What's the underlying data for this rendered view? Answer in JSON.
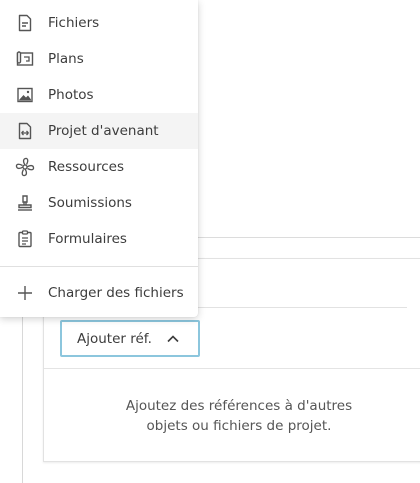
{
  "menu": {
    "items": [
      {
        "label": "Fichiers",
        "icon": "file-icon"
      },
      {
        "label": "Plans",
        "icon": "plans-icon"
      },
      {
        "label": "Photos",
        "icon": "photo-icon"
      },
      {
        "label": "Projet d'avenant",
        "icon": "change-order-icon"
      },
      {
        "label": "Ressources",
        "icon": "fan-icon"
      },
      {
        "label": "Soumissions",
        "icon": "stamp-icon"
      },
      {
        "label": "Formulaires",
        "icon": "clipboard-icon"
      }
    ],
    "upload_label": "Charger des fichiers",
    "upload_icon": "plus-icon",
    "active_item": "Projet d'avenant"
  },
  "references": {
    "add_button_label": "Ajouter réf.",
    "add_button_icon": "chevron-up-icon",
    "empty_line1": "Ajoutez des références à d'autres",
    "empty_line2": "objets ou fichiers de projet."
  },
  "colors": {
    "focus_border": "#8cc6dd",
    "active_row": "#f4f4f4",
    "text": "#3c3c3c"
  }
}
